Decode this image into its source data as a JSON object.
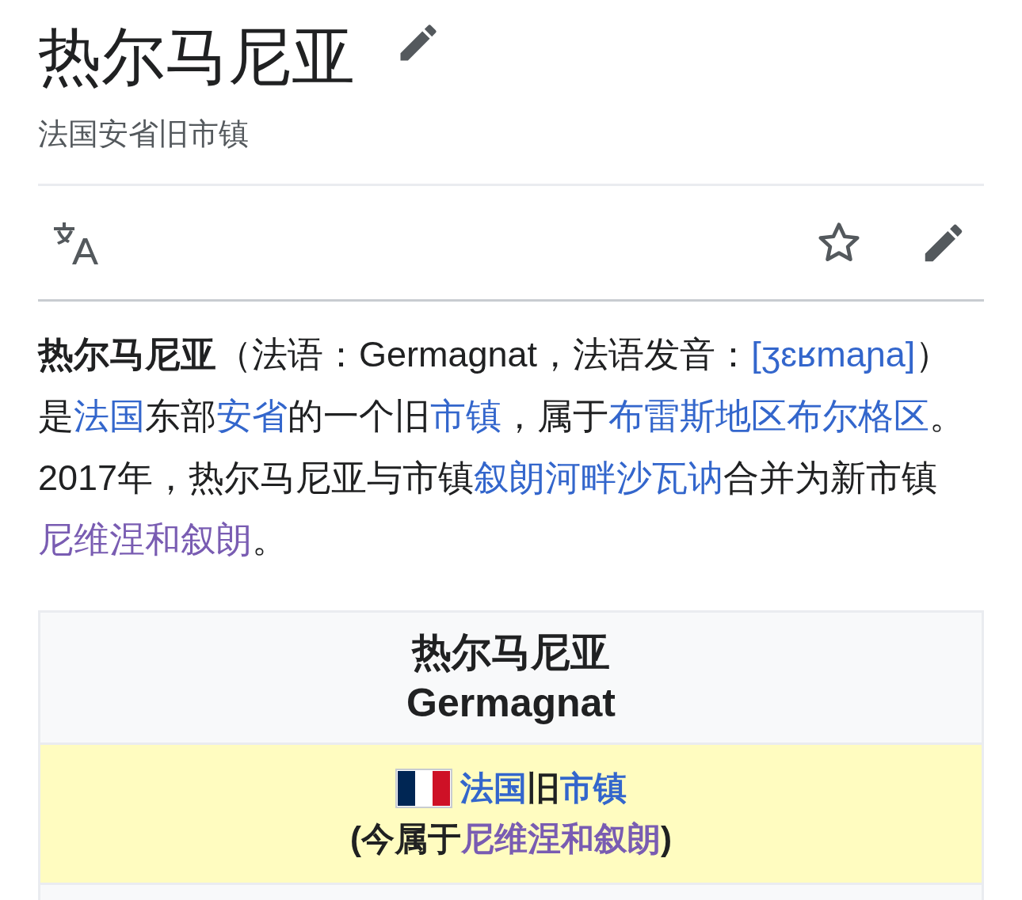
{
  "title": "热尔马尼亚",
  "subtitle": "法国安省旧市镇",
  "toolbar": {
    "watched": false
  },
  "lead": [
    {
      "kind": "bold",
      "text": "热尔马尼亚"
    },
    {
      "kind": "plain",
      "text": "（法语：Germagnat，法语发音："
    },
    {
      "kind": "link",
      "text": "[ʒɛʁmaɲa]"
    },
    {
      "kind": "plain",
      "text": "）是"
    },
    {
      "kind": "link",
      "text": "法国"
    },
    {
      "kind": "plain",
      "text": "东部"
    },
    {
      "kind": "link",
      "text": "安省"
    },
    {
      "kind": "plain",
      "text": "的一个旧"
    },
    {
      "kind": "link",
      "text": "市镇"
    },
    {
      "kind": "plain",
      "text": "，属于"
    },
    {
      "kind": "link",
      "text": "布雷斯地区布尔格区"
    },
    {
      "kind": "plain",
      "text": "。2017年，热尔马尼亚与市镇"
    },
    {
      "kind": "link",
      "text": "叙朗河畔沙瓦讷"
    },
    {
      "kind": "plain",
      "text": "合并为新市镇"
    },
    {
      "kind": "visited",
      "text": "尼维涅和叙朗"
    },
    {
      "kind": "plain",
      "text": "。"
    }
  ],
  "infobox": {
    "title_lines": [
      "热尔马尼亚",
      "Germagnat"
    ],
    "status_line1": [
      {
        "kind": "link",
        "text": "法国"
      },
      {
        "kind": "plain",
        "text": "旧"
      },
      {
        "kind": "link",
        "text": "市镇"
      }
    ],
    "status_line2": [
      {
        "kind": "plain",
        "text": "(今属于"
      },
      {
        "kind": "visited",
        "text": "尼维涅和叙朗"
      },
      {
        "kind": "plain",
        "text": ")"
      }
    ]
  }
}
